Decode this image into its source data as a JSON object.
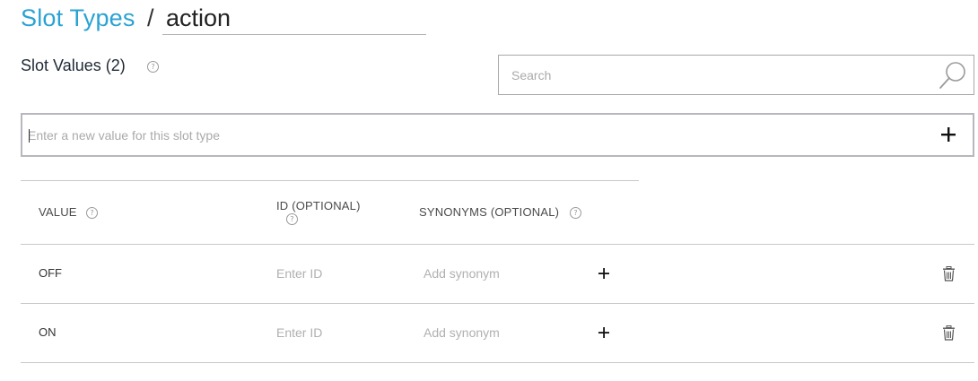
{
  "header": {
    "breadcrumb_root": "Slot Types",
    "separator": "/",
    "slot_type_name": "action"
  },
  "section": {
    "title": "Slot Values (2)",
    "help_glyph": "?"
  },
  "search": {
    "placeholder": "Search",
    "icon": "search-icon"
  },
  "new_value": {
    "placeholder": "Enter a new value for this slot type",
    "add_icon": "plus-icon"
  },
  "table": {
    "columns": [
      {
        "label": "VALUE",
        "help": "?"
      },
      {
        "label": "ID (OPTIONAL)",
        "help": "?"
      },
      {
        "label": "SYNONYMS (OPTIONAL)",
        "help": "?"
      }
    ],
    "rows": [
      {
        "value": "OFF",
        "id_placeholder": "Enter ID",
        "synonym_placeholder": "Add synonym"
      },
      {
        "value": "ON",
        "id_placeholder": "Enter ID",
        "synonym_placeholder": "Add synonym"
      }
    ]
  },
  "colors": {
    "accent": "#2aa2d4",
    "border": "#b7b7be",
    "placeholder": "#aaaaaa"
  }
}
